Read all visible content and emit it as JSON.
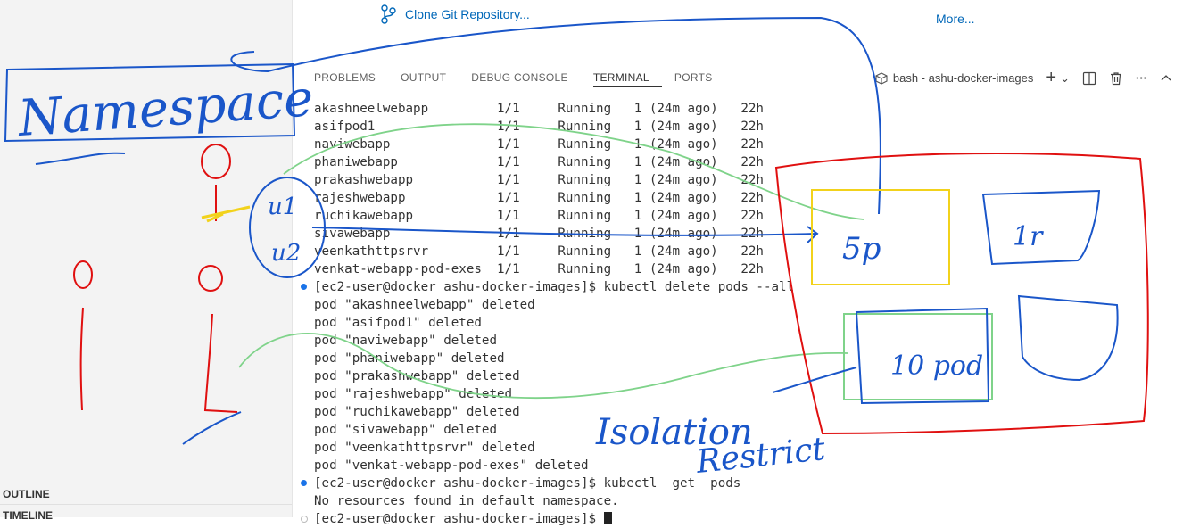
{
  "sidebar": {
    "sections": [
      "OUTLINE",
      "TIMELINE"
    ]
  },
  "welcome": {
    "clone_link": "Clone Git Repository...",
    "more_link": "More..."
  },
  "panel": {
    "tabs": [
      "PROBLEMS",
      "OUTPUT",
      "DEBUG CONSOLE",
      "TERMINAL",
      "PORTS"
    ],
    "active_tab": "TERMINAL",
    "terminal_name": "bash - ashu-docker-images",
    "actions": {
      "new_terminal": "+",
      "dropdown": "⌄",
      "more": "···",
      "maximize": "^"
    }
  },
  "terminal": {
    "lines": [
      {
        "text": "akashneelwebapp         1/1     Running   1 (24m ago)   22h",
        "dot": ""
      },
      {
        "text": "asifpod1                1/1     Running   1 (24m ago)   22h",
        "dot": ""
      },
      {
        "text": "naviwebapp              1/1     Running   1 (24m ago)   22h",
        "dot": ""
      },
      {
        "text": "phaniwebapp             1/1     Running   1 (24m ago)   22h",
        "dot": ""
      },
      {
        "text": "prakashwebapp           1/1     Running   1 (24m ago)   22h",
        "dot": ""
      },
      {
        "text": "rajeshwebapp            1/1     Running   1 (24m ago)   22h",
        "dot": ""
      },
      {
        "text": "ruchikawebapp           1/1     Running   1 (24m ago)   22h",
        "dot": ""
      },
      {
        "text": "sivawebapp              1/1     Running   1 (24m ago)   22h",
        "dot": ""
      },
      {
        "text": "veenkathttpsrvr         1/1     Running   1 (24m ago)   22h",
        "dot": ""
      },
      {
        "text": "venkat-webapp-pod-exes  1/1     Running   1 (24m ago)   22h",
        "dot": ""
      },
      {
        "text": "[ec2-user@docker ashu-docker-images]$ kubectl delete pods --all",
        "dot": "filled"
      },
      {
        "text": "pod \"akashneelwebapp\" deleted",
        "dot": ""
      },
      {
        "text": "pod \"asifpod1\" deleted",
        "dot": ""
      },
      {
        "text": "pod \"naviwebapp\" deleted",
        "dot": ""
      },
      {
        "text": "pod \"phaniwebapp\" deleted",
        "dot": ""
      },
      {
        "text": "pod \"prakashwebapp\" deleted",
        "dot": ""
      },
      {
        "text": "pod \"rajeshwebapp\" deleted",
        "dot": ""
      },
      {
        "text": "pod \"ruchikawebapp\" deleted",
        "dot": ""
      },
      {
        "text": "pod \"sivawebapp\" deleted",
        "dot": ""
      },
      {
        "text": "pod \"veenkathttpsrvr\" deleted",
        "dot": ""
      },
      {
        "text": "pod \"venkat-webapp-pod-exes\" deleted",
        "dot": ""
      },
      {
        "text": "[ec2-user@docker ashu-docker-images]$ kubectl  get  pods",
        "dot": "filled"
      },
      {
        "text": "No resources found in default namespace.",
        "dot": ""
      },
      {
        "text": "[ec2-user@docker ashu-docker-images]$ ",
        "dot": "hollow",
        "cursor": true
      }
    ]
  },
  "annotations": {
    "namespace_label": "Namespace",
    "isolation_label": "Isolation",
    "restrict_label": "Restrict",
    "box_labels": [
      "5p",
      "1r",
      "10 pod"
    ],
    "user_labels": [
      "u1",
      "u2"
    ],
    "colors": {
      "blue": "#1a56c9",
      "red": "#e01010",
      "green": "#7fd38a",
      "yellow": "#f2d21b"
    }
  }
}
